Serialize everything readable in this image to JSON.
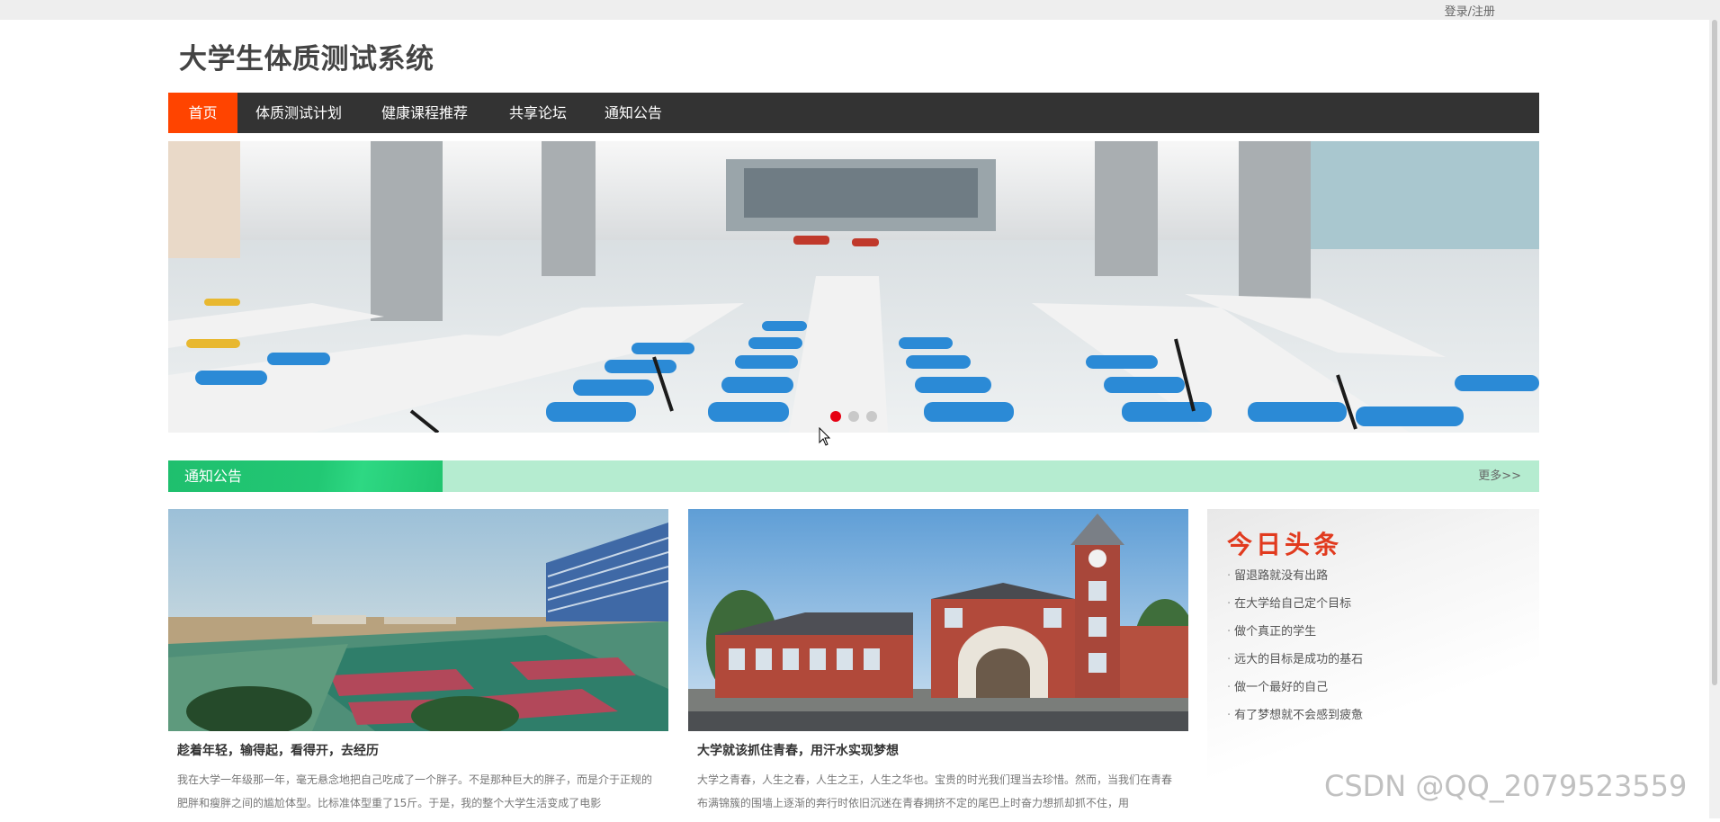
{
  "topbar": {
    "login_label": "登录/注册"
  },
  "site": {
    "title": "大学生体质测试系统"
  },
  "nav": {
    "items": [
      {
        "label": "首页",
        "active": true
      },
      {
        "label": "体质测试计划"
      },
      {
        "label": "健康课程推荐"
      },
      {
        "label": "共享论坛"
      },
      {
        "label": "通知公告"
      }
    ]
  },
  "banner": {
    "slide_count": 3,
    "active_slide": 1
  },
  "notice_section": {
    "title": "通知公告",
    "more_label": "更多>>"
  },
  "articles": [
    {
      "title": "趁着年轻，输得起，看得开，去经历",
      "excerpt": "我在大学一年级那一年，毫无悬念地把自己吃成了一个胖子。不是那种巨大的胖子，而是介于正规的肥胖和瘦胖之间的尴尬体型。比标准体型重了15斤。于是，我的整个大学生活变成了电影"
    },
    {
      "title": "大学就该抓住青春，用汗水实现梦想",
      "excerpt": "大学之青春，人生之春，人生之王，人生之华也。宝贵的时光我们理当去珍惜。然而，当我们在青春布满锦簇的围墙上逐渐的奔行时依旧沉迷在青春拥挤不定的尾巴上时奋力想抓却抓不住，用"
    }
  ],
  "headlines": {
    "heading": "今日头条",
    "items": [
      "留退路就没有出路",
      "在大学给自己定个目标",
      "做个真正的学生",
      "远大的目标是成功的基石",
      "做一个最好的自己",
      "有了梦想就不会感到疲惫"
    ]
  },
  "watermark": "CSDN @QQ_2079523559",
  "colors": {
    "nav_bg": "#333333",
    "nav_active": "#ff4400",
    "section_green": "#22c874",
    "section_bar": "#b5ecd0",
    "headline_red": "#e13a1e",
    "dot_active": "#e60012"
  }
}
